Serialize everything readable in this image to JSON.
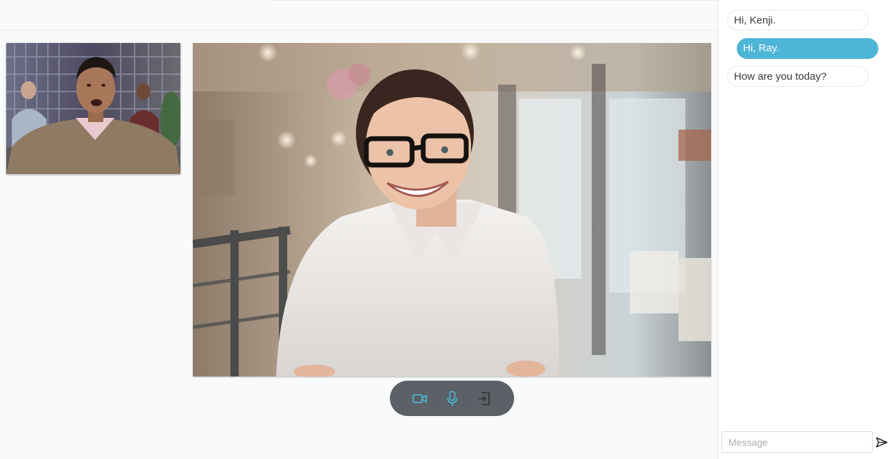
{
  "call": {
    "controls": [
      {
        "name": "camera-toggle-button",
        "icon": "video-camera-icon",
        "color": "#4db5d5"
      },
      {
        "name": "microphone-toggle-button",
        "icon": "microphone-icon",
        "color": "#4db5d5"
      },
      {
        "name": "leave-call-button",
        "icon": "exit-icon",
        "color": "#2f3438"
      }
    ],
    "control_bar_color": "#5b6166"
  },
  "chat": {
    "messages": [
      {
        "text": "Hi, Kenji.",
        "direction": "incoming"
      },
      {
        "text": "Hi, Ray.",
        "direction": "outgoing"
      },
      {
        "text": "How are you today?",
        "direction": "incoming"
      }
    ],
    "input_placeholder": "Message",
    "input_value": "",
    "outgoing_bubble_color": "#4db5d5",
    "send_icon": "send-arrow-icon"
  }
}
